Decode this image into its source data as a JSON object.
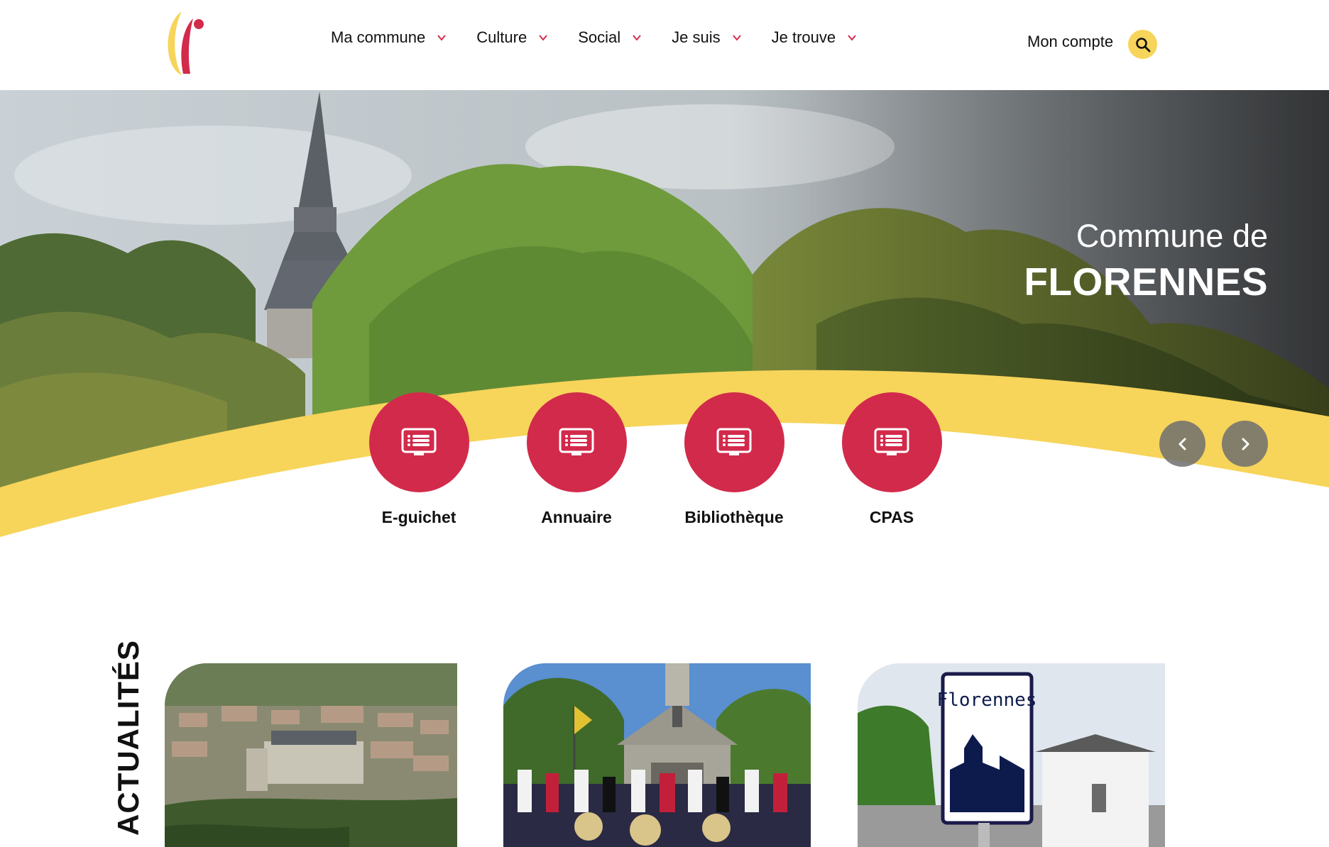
{
  "header": {
    "nav": [
      {
        "label": "Ma commune"
      },
      {
        "label": "Culture"
      },
      {
        "label": "Social"
      },
      {
        "label": "Je suis"
      },
      {
        "label": "Je trouve"
      }
    ],
    "account_label": "Mon compte",
    "search_icon": "search-icon"
  },
  "hero": {
    "subtitle": "Commune de",
    "title": "FLORENNES",
    "prev_icon": "chevron-left-icon",
    "next_icon": "chevron-right-icon"
  },
  "shortcuts": [
    {
      "label": "E-guichet",
      "icon": "screen-list-icon"
    },
    {
      "label": "Annuaire",
      "icon": "screen-list-icon"
    },
    {
      "label": "Bibliothèque",
      "icon": "screen-list-icon"
    },
    {
      "label": "CPAS",
      "icon": "screen-list-icon"
    }
  ],
  "news": {
    "heading": "ACTUALITÉS"
  },
  "colors": {
    "accent_red": "#d22a4b",
    "accent_yellow": "#f7d45a",
    "text": "#111111"
  }
}
